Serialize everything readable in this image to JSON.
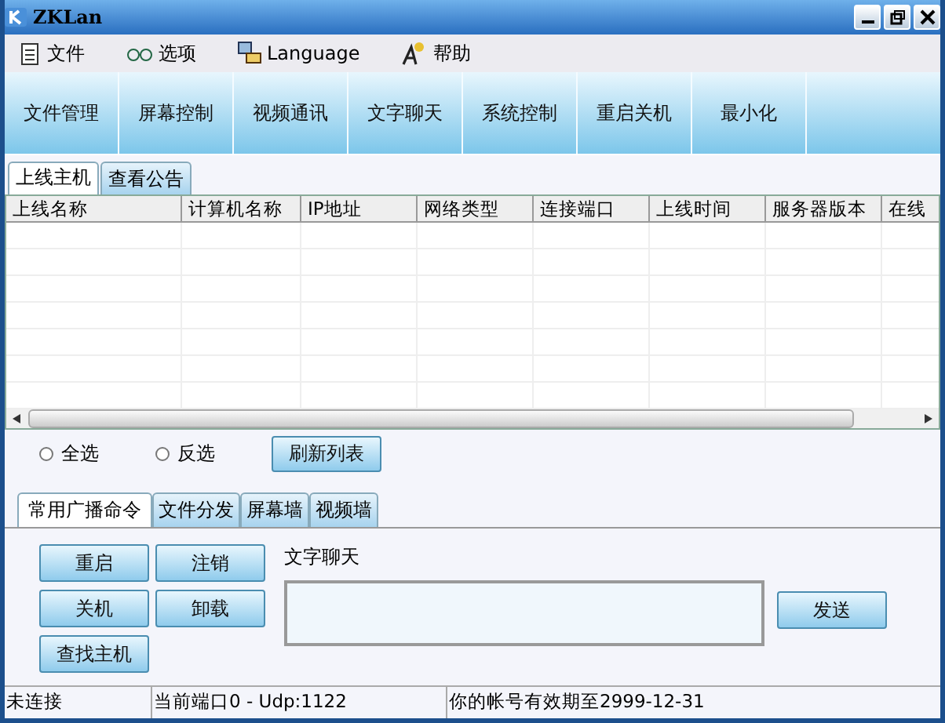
{
  "window": {
    "title": "ZKLan"
  },
  "menu": [
    {
      "label": "文件"
    },
    {
      "label": "选项"
    },
    {
      "label": "Language"
    },
    {
      "label": "帮助"
    }
  ],
  "toolbar": [
    "文件管理",
    "屏幕控制",
    "视频通讯",
    "文字聊天",
    "系统控制",
    "重启关机",
    "最小化"
  ],
  "tabs": [
    {
      "label": "上线主机",
      "selected": true
    },
    {
      "label": "查看公告",
      "selected": false
    }
  ],
  "table": {
    "columns": [
      "上线名称",
      "计算机名称",
      "IP地址",
      "网络类型",
      "连接端口",
      "上线时间",
      "服务器版本",
      "在线"
    ]
  },
  "selection": {
    "options": [
      {
        "label": "全选",
        "selected": false
      },
      {
        "label": "反选",
        "selected": false
      }
    ],
    "refresh_button": "刷新列表"
  },
  "command_tabs": [
    {
      "label": "常用广播命令",
      "selected": true
    },
    {
      "label": "文件分发",
      "selected": false
    },
    {
      "label": "屏幕墙",
      "selected": false
    },
    {
      "label": "视频墙",
      "selected": false
    }
  ],
  "commands": [
    "重启",
    "注销",
    "关机",
    "卸载",
    "查找主机"
  ],
  "chat": {
    "label": "文字聊天",
    "send_button": "发送"
  },
  "status_bar": [
    "未连接",
    "当前端口0 - Udp:1122",
    "你的帐号有效期至2999-12-31"
  ]
}
